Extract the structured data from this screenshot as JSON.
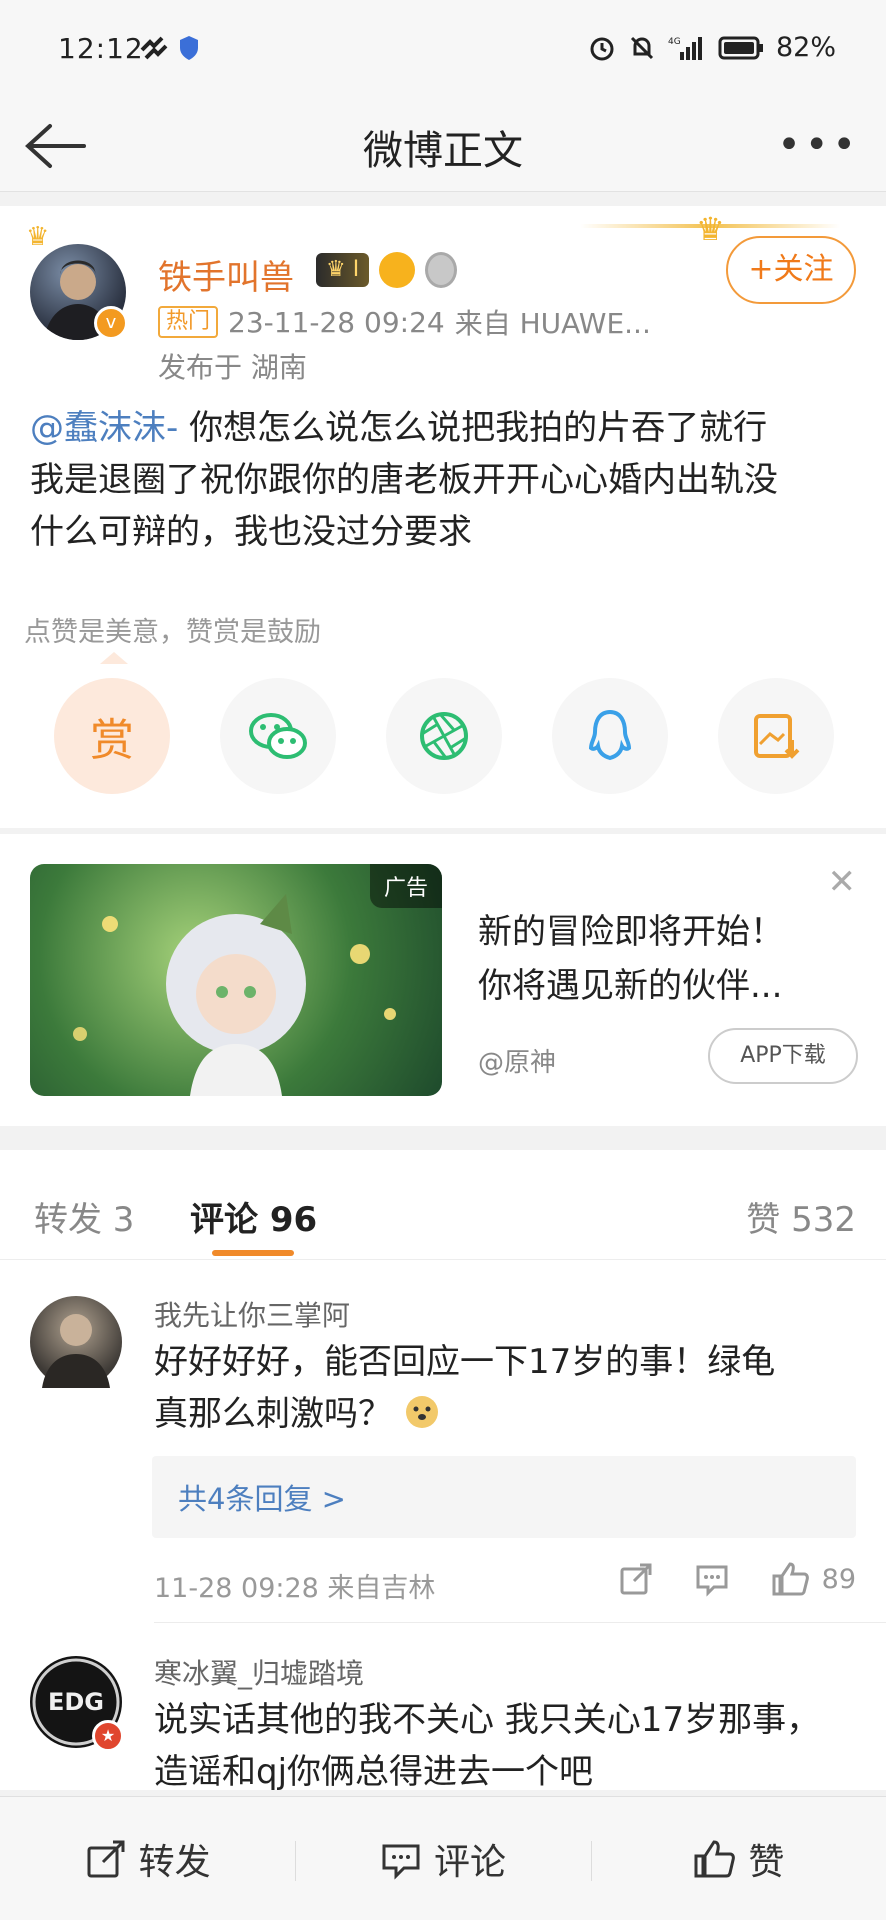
{
  "status_bar": {
    "time": "12:12",
    "battery": "82%"
  },
  "nav": {
    "title": "微博正文",
    "more": "•••"
  },
  "post": {
    "author": "铁手叫兽",
    "vip_label": "I",
    "hot_tag": "热门",
    "datetime": "23-11-28 09:24",
    "source": "来自 HUAWE...",
    "location": "发布于 湖南",
    "follow_label": "+关注",
    "mention": "@蠢沫沫-",
    "text_1": " 你想怎么说怎么说把我拍的片吞了就行",
    "text_2": "我是退圈了祝你跟你的唐老板开开心心婚内出轨没",
    "text_3": "什么可辩的，我也没过分要求",
    "reward_tip": "点赞是美意，赞赏是鼓励",
    "reward_char": "赏"
  },
  "ad": {
    "tag": "广告",
    "line1": "新的冒险即将开始！",
    "line2": "你将遇见新的伙伴...",
    "source": "@原神",
    "button": "APP下载",
    "close": "✕"
  },
  "tabs": {
    "repost": "转发 3",
    "comment": "评论 96",
    "like": "赞 532"
  },
  "comments": [
    {
      "name": "我先让你三掌阿",
      "line1": "好好好好，能否回应一下17岁的事！绿龟",
      "line2": "真那么刺激吗？",
      "reply": "共4条回复 >",
      "meta": "11-28 09:28  来自吉林",
      "likes": "89"
    },
    {
      "name": "寒冰翼_归墟踏境",
      "line1": "说实话其他的我不关心 我只关心17岁那事，",
      "line2": "造谣和qj你俩总得进去一个吧",
      "avatar_text": "EDG"
    }
  ],
  "bottom_bar": {
    "repost": "转发",
    "comment": "评论",
    "like": "赞"
  }
}
